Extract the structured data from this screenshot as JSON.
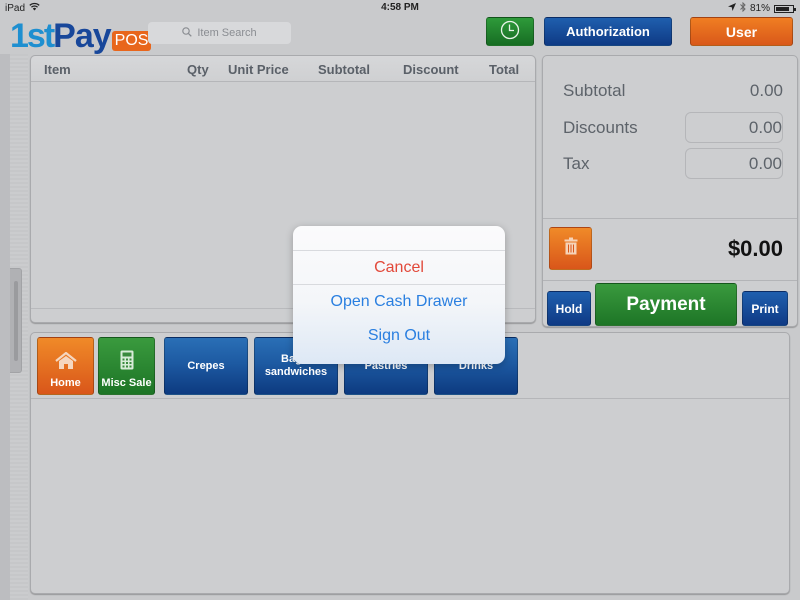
{
  "status_bar": {
    "device": "iPad",
    "wifi_icon": "wifi-icon",
    "time": "4:58 PM",
    "location_icon": "location-arrow-icon",
    "bluetooth_icon": "bluetooth-icon",
    "battery_percent": "81%",
    "battery_level": 0.81
  },
  "header": {
    "logo": {
      "part1": "1st",
      "part2": "Pay",
      "part3": "POS"
    },
    "search": {
      "placeholder": "Item Search",
      "value": "",
      "icon": "search-icon"
    },
    "clock_button": {
      "icon": "clock-icon"
    },
    "authorization_label": "Authorization",
    "user_label": "User"
  },
  "colors": {
    "green": "#1d7526",
    "blue": "#0f3a85",
    "orange": "#d9561a",
    "cancel_red": "#e2493a",
    "action_blue": "#2a7fe0"
  },
  "order_table": {
    "columns": [
      "Item",
      "Qty",
      "Unit Price",
      "Subtotal",
      "Discount",
      "Total"
    ],
    "rows": []
  },
  "totals": {
    "subtotal_label": "Subtotal",
    "subtotal_value": "0.00",
    "discounts_label": "Discounts",
    "discounts_value": "0.00",
    "tax_label": "Tax",
    "tax_value": "0.00",
    "grand_total": "$0.00",
    "trash_icon": "trash-icon",
    "hold_label": "Hold",
    "payment_label": "Payment",
    "print_label": "Print"
  },
  "categories": {
    "home_label": "Home",
    "misc_label": "Misc Sale",
    "items": [
      {
        "line1": "Crepes",
        "line2": ""
      },
      {
        "line1": "Bagel",
        "line2": "sandwiches"
      },
      {
        "line1": "Pastries",
        "line2": ""
      },
      {
        "line1": "Drinks",
        "line2": ""
      }
    ]
  },
  "popover": {
    "cancel_label": "Cancel",
    "open_cash_drawer_label": "Open Cash Drawer",
    "sign_out_label": "Sign Out"
  }
}
